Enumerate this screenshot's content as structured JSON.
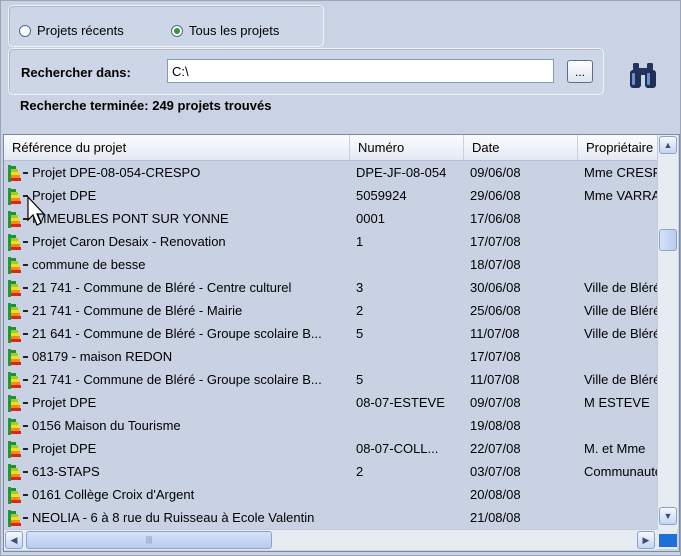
{
  "filters": {
    "recent_label": "Projets récents",
    "all_label": "Tous les projets",
    "selected": "all"
  },
  "search": {
    "label": "Rechercher dans:",
    "value": "C:\\",
    "browse_label": "..."
  },
  "status_text": "Recherche terminée: 249 projets trouvés",
  "table": {
    "columns": [
      "Référence du projet",
      "Numéro",
      "Date",
      "Propriétaire"
    ],
    "rows": [
      [
        "Projet DPE-08-054-CRESPO",
        "DPE-JF-08-054",
        "09/06/08",
        "Mme CRESPO"
      ],
      [
        "Projet DPE",
        "5059924",
        "29/06/08",
        "Mme VARRAS"
      ],
      [
        "IMMEUBLES PONT SUR YONNE",
        "0001",
        "17/06/08",
        ""
      ],
      [
        "Projet Caron Desaix - Renovation",
        "1",
        "17/07/08",
        ""
      ],
      [
        "commune de besse",
        "",
        "18/07/08",
        ""
      ],
      [
        "21 741 - Commune de Bléré - Centre culturel",
        "3",
        "30/06/08",
        "Ville de Bléré"
      ],
      [
        "21 741 - Commune de Bléré - Mairie",
        "2",
        "25/06/08",
        "Ville de Bléré"
      ],
      [
        "21 641 - Commune de Bléré - Groupe scolaire B...",
        "5",
        "11/07/08",
        "Ville de Bléré"
      ],
      [
        "08179 - maison REDON",
        "",
        "17/07/08",
        ""
      ],
      [
        "21 741 - Commune de Bléré - Groupe scolaire B...",
        "5",
        "11/07/08",
        "Ville de Bléré"
      ],
      [
        "Projet DPE",
        "08-07-ESTEVE",
        "09/07/08",
        "M ESTEVE"
      ],
      [
        "0156 Maison du Tourisme",
        "",
        "19/08/08",
        ""
      ],
      [
        "Projet DPE",
        "08-07-COLL...",
        "22/07/08",
        "M. et Mme"
      ],
      [
        "613-STAPS",
        "2",
        "03/07/08",
        "Communauté"
      ],
      [
        "0161 Collège Croix d'Argent",
        "",
        "20/08/08",
        ""
      ],
      [
        "NEOLIA - 6 à 8 rue du Ruisseau à Ecole Valentin",
        "",
        "21/08/08",
        ""
      ]
    ]
  },
  "icons": {
    "search_button": "binoculars-icon",
    "row_icon": "energy-rating-icon"
  },
  "colors": {
    "panel_bg": "#c9d3e4",
    "list_bg": "#c8d2e3",
    "radio_selected": "#2f9a2f"
  }
}
